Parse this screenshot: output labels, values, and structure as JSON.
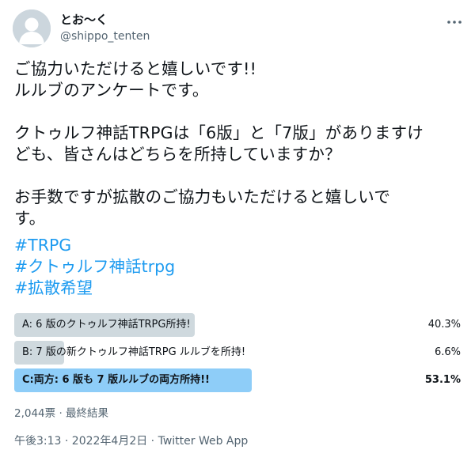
{
  "author": {
    "display_name": "とお～く",
    "handle": "@shippo_tenten"
  },
  "tweet": {
    "text": "ご協力いただけると嬉しいです!!\nルルブのアンケートです。\n\nクトゥルフ神話TRPGは「6版」と「7版」がありますけ\nども、皆さんはどちらを所持していますか？\n\nお手数ですが拡散のご協力もいただけると嬉しいで\nす。",
    "hashtags": [
      "#TRPG",
      "#クトゥルフ神話trpg",
      "#拡散希望"
    ]
  },
  "poll": {
    "options": [
      {
        "label": "A: 6 版のクトゥルフ神話TRPG所持!",
        "percent": "40.3%",
        "fraction": 0.403,
        "winner": false
      },
      {
        "label": "B: 7 版の新クトゥルフ神話TRPG ルルブを所持!",
        "percent": "6.6%",
        "fraction": 0.066,
        "winner": false
      },
      {
        "label": "C:両方: 6 版も 7 版ルルブの両方所持!!",
        "percent": "53.1%",
        "fraction": 0.531,
        "winner": true
      }
    ],
    "summary": "2,044票 · 最終結果"
  },
  "meta": {
    "timestamp": "午後3:13 · 2022年4月2日 · Twitter Web App"
  },
  "icons": {
    "avatar": "default-avatar-icon",
    "more": "more-options-icon"
  },
  "colors": {
    "link": "#1d9bf0",
    "poll_bar": "#cfd9de",
    "poll_winner_bar": "#8ecdf8",
    "secondary_text": "#536471"
  }
}
